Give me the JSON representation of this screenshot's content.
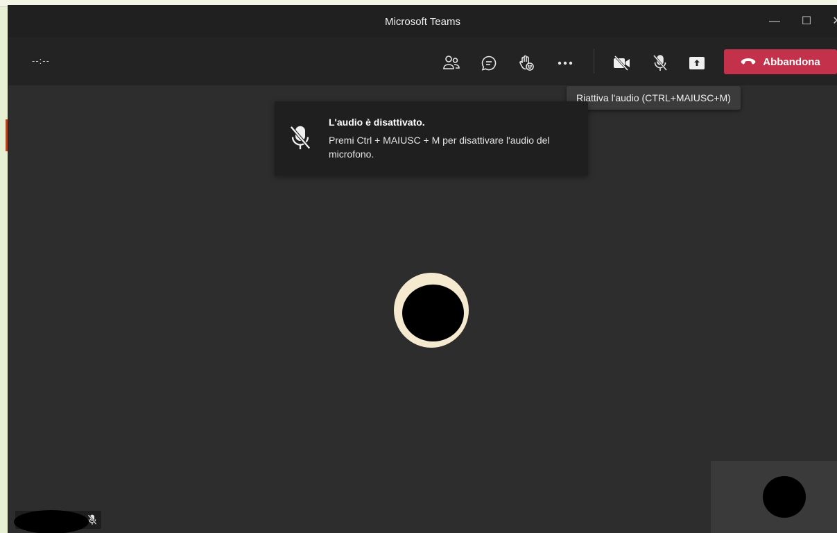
{
  "window": {
    "title": "Microsoft Teams",
    "controls": {
      "minimize": "—",
      "maximize": "☐",
      "close": "✕"
    }
  },
  "toolbar": {
    "timer": "--:--",
    "buttons": [
      {
        "name": "people",
        "icon": "people-icon"
      },
      {
        "name": "chat",
        "icon": "chat-icon"
      },
      {
        "name": "raise-hand",
        "icon": "raise-hand-icon"
      },
      {
        "name": "more-actions",
        "icon": "more-icon"
      },
      {
        "name": "camera-off",
        "icon": "video-off-icon"
      },
      {
        "name": "mic-muted",
        "icon": "mic-off-icon"
      },
      {
        "name": "share",
        "icon": "share-icon"
      }
    ],
    "leave_label": "Abbandona"
  },
  "tooltip": {
    "text": "Riattiva l'audio (CTRL+MAIUSC+M)"
  },
  "toast": {
    "title": "L'audio è disattivato.",
    "body": "Premi Ctrl + MAIUSC + M per disattivare l'audio del microfono."
  },
  "colors": {
    "leave_button": "#c4314b",
    "window_bg": "#2d2d2d",
    "toolbar_bg": "#232323",
    "avatar_ring": "#f5e9cf"
  }
}
